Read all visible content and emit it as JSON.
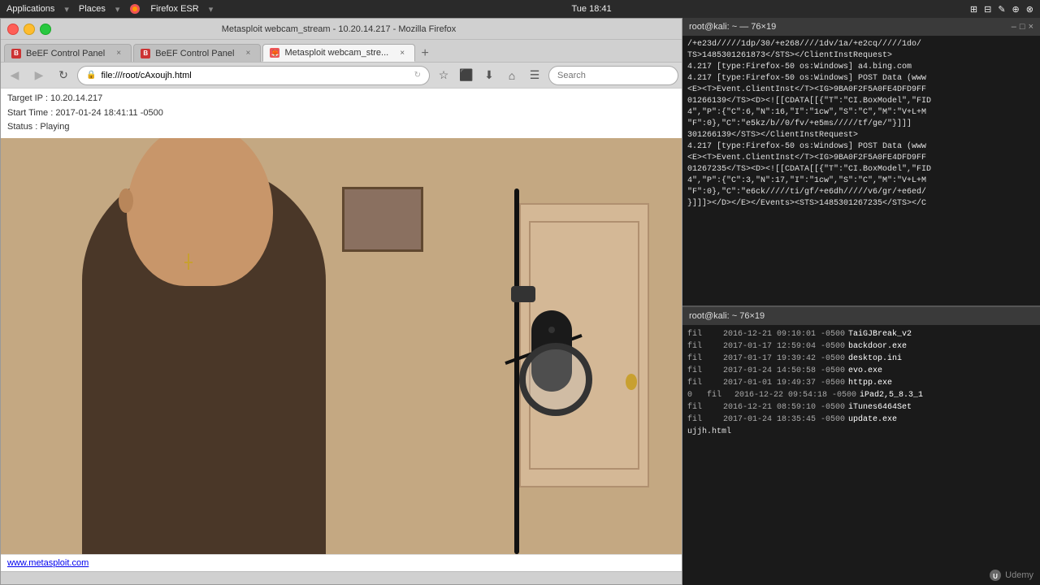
{
  "os_bar": {
    "left_items": [
      "Applications",
      "Places",
      "Firefox ESR"
    ],
    "datetime": "Tue 18:41",
    "right_icons": [
      "network",
      "volume",
      "battery",
      "settings"
    ]
  },
  "browser": {
    "title": "Metasploit webcam_stream - 10.20.14.217 - Mozilla Firefox",
    "tabs": [
      {
        "id": "tab1",
        "label": "BeEF Control Panel",
        "favicon": "beef",
        "active": false,
        "closeable": true
      },
      {
        "id": "tab2",
        "label": "BeEF Control Panel",
        "favicon": "beef",
        "active": false,
        "closeable": true
      },
      {
        "id": "tab3",
        "label": "Metasploit webcam_stre...",
        "favicon": "ff",
        "active": true,
        "closeable": true
      }
    ],
    "address": "file:///root/cAxoujh.html",
    "search_placeholder": "Search",
    "info": {
      "target_ip_label": "Target IP",
      "target_ip_value": "10.20.14.217",
      "start_time_label": "Start Time",
      "start_time_value": "2017-01-24 18:41:11 -0500",
      "status_label": "Status",
      "status_value": "Playing"
    },
    "footer_link": "www.metasploit.com"
  },
  "terminal_top": {
    "title": "root@kali: ~",
    "size": "76×19",
    "lines": [
      "/+e23d/////1dp/30/+e268////1dv/1a/+e2cq/////1do/",
      "TS>1485301261873</STS></ClientInstRequest>",
      "4.217 [type:Firefox-50 os:Windows] a4.bing.com",
      "4.217 [type:Firefox-50 os:Windows] POST Data (www",
      "<E><T>Event.ClientInst</T><IG>9BA0F2F5A0FE4DFD9FF",
      "01266139</TS><D><![[CDATA[[{\"T\":\"CI.BoxModel\",\"FID",
      "4\",\"P\":{\"C\":6,\"N\":16,\"I\":\"1cw\",\"S\":\"C\",\"M\":\"V+L+M",
      "\"F\":0},\"C\":\"e5kz/b//0/fv/+e5ms/////tf/ge/\"}]]]",
      "301266139</STS></ClientInstRequest>",
      "4.217 [type:Firefox-50 os:Windows] POST Data (www",
      "<E><T>Event.ClientInst</T><IG>9BA0F2F5A0FE4DFD9FF",
      "01267235</TS><D><![[CDATA[[{\"T\":\"CI.BoxModel\",\"FID",
      "4\",\"P\":{\"C\":3,\"N\":17,\"I\":\"1cw\",\"S\":\"C\",\"M\":\"V+L+M",
      "\"F\":0},\"C\":\"e6ck/////ti/gf/+e6dh/////v6/gr/+e6ed/",
      "}]]]></D></E></Events><STS>1485301267235</STS></C"
    ]
  },
  "terminal_bottom": {
    "title": "root@kali: ~ 76×19",
    "files": [
      {
        "type": "fil",
        "date": "2016-12-21 09:10:01 -0500",
        "name": "TaiGJBreak_v2"
      },
      {
        "type": "fil",
        "date": "2017-01-17 12:59:04 -0500",
        "name": "backdoor.exe"
      },
      {
        "type": "fil",
        "date": "2017-01-17 19:39:42 -0500",
        "name": "desktop.ini"
      },
      {
        "type": "fil",
        "date": "2017-01-24 14:50:58 -0500",
        "name": "evo.exe"
      },
      {
        "type": "fil",
        "date": "2017-01-01 19:49:37 -0500",
        "name": "httpp.exe"
      },
      {
        "type": "0   fil",
        "date": "2016-12-22 09:54:18 -0500",
        "name": "iPad2,5_8.3_1"
      },
      {
        "type": "fil",
        "date": "2016-12-21 08:59:10 -0500",
        "name": "iTunes6464Set"
      },
      {
        "type": "fil",
        "date": "2017-01-24 18:35:45 -0500",
        "name": "update.exe"
      }
    ],
    "prompt_line": "ujjh.html"
  },
  "udemy": {
    "watermark": "Udemy"
  }
}
